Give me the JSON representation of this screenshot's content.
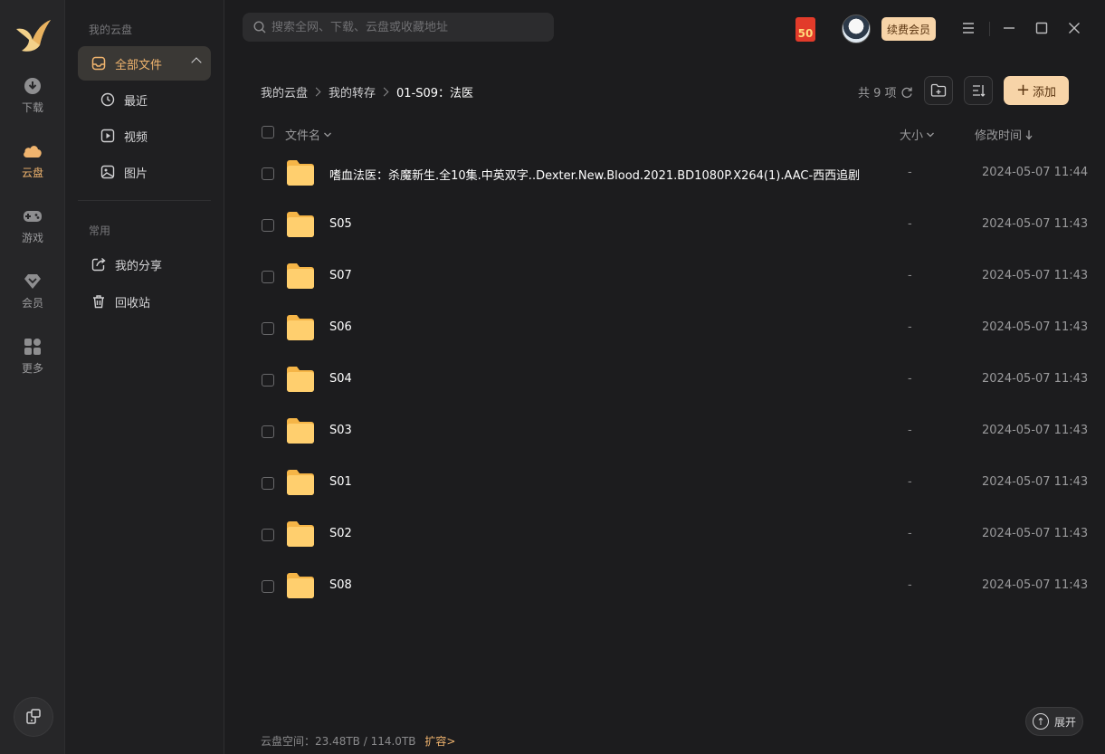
{
  "rail": {
    "items": [
      {
        "label": "下载",
        "icon": "download-icon"
      },
      {
        "label": "云盘",
        "icon": "cloud-icon"
      },
      {
        "label": "游戏",
        "icon": "gamepad-icon"
      },
      {
        "label": "会员",
        "icon": "diamond-icon"
      },
      {
        "label": "更多",
        "icon": "grid-icon"
      }
    ],
    "active_index": 1,
    "accent_color": "#f0b46e"
  },
  "nav": {
    "section_title": "我的云盘",
    "all_files": "全部文件",
    "recent": "最近",
    "video": "视频",
    "image": "图片",
    "common_title": "常用",
    "my_share": "我的分享",
    "recycle": "回收站"
  },
  "search": {
    "placeholder": "搜索全网、下载、云盘或收藏地址"
  },
  "topbar": {
    "red_packet": "50",
    "vip_label": "续费会员"
  },
  "breadcrumb": {
    "root": "我的云盘",
    "level1": "我的转存",
    "current": "01-S09：法医"
  },
  "toolbar": {
    "count": "共 9 项",
    "add_label": "添加"
  },
  "table": {
    "col_name": "文件名",
    "col_size": "大小",
    "col_date": "修改时间",
    "rows": [
      {
        "name": "嗜血法医：杀魔新生.全10集.中英双字..Dexter.New.Blood.2021.BD1080P.X264(1).AAC-西西追剧",
        "size": "-",
        "date": "2024-05-07 11:44"
      },
      {
        "name": "S05",
        "size": "-",
        "date": "2024-05-07 11:43"
      },
      {
        "name": "S07",
        "size": "-",
        "date": "2024-05-07 11:43"
      },
      {
        "name": "S06",
        "size": "-",
        "date": "2024-05-07 11:43"
      },
      {
        "name": "S04",
        "size": "-",
        "date": "2024-05-07 11:43"
      },
      {
        "name": "S03",
        "size": "-",
        "date": "2024-05-07 11:43"
      },
      {
        "name": "S01",
        "size": "-",
        "date": "2024-05-07 11:43"
      },
      {
        "name": "S02",
        "size": "-",
        "date": "2024-05-07 11:43"
      },
      {
        "name": "S08",
        "size": "-",
        "date": "2024-05-07 11:43"
      }
    ]
  },
  "footer": {
    "storage": "云盘空间：23.48TB / 114.0TB",
    "expand": "扩容>",
    "unfold": "展开"
  }
}
